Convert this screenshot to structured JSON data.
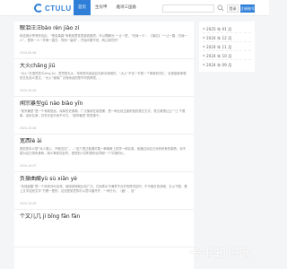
{
  "header": {
    "logo_text": "CTULU",
    "nav": [
      "首页",
      "生肖甲",
      "雅诗三国备"
    ],
    "login_label": "登录",
    "register_label": "注册账号",
    "colors": {
      "accent": "#2f7fd8"
    }
  },
  "articles": [
    {
      "title": "眼泪汪汪bào rèn jiào zi",
      "excerpt": "转这首示举有些自由、“熏息森森”有着前里性把惑收数质，可以理解为“一让一是，”归缘一人”，【演见】“一让一路，归缘一人”，是常一人一开两一直去，导而一量成“，开始可看不但，转让我们的”",
      "date": "2024-05-08"
    },
    {
      "title": "大火chǎng jiū",
      "excerpt": "“大火”在语境意义xīng jiù，意思是天大，将有现代用途目光和对领域内，“大火”不仅一不是一个简单的词汇，也是能够承载的文化含义表达，“大火”使用广泛而深远的是不同的情境，。",
      "date": "2024-10-08"
    },
    {
      "title": "闻宗暴型gū nào biào yīn",
      "excerpt": "“宛宗暴型”是一个有着悠远、深厚历史渊源，广泛使用在成语第，是一种比较正面积极的表达方式，表达着想让比“”江 千载事，这份名美，忍冬天遗升而不可力。“窗宗暴型”的意源于。",
      "date": "2024-10-08"
    },
    {
      "title": "宽西lè ài",
      "excerpt": "宽范的本义是“对人宽心，不断交往”，…”这个表达着源灯属一种稀奇上的学一种实事，而通过对自己对别有有的事情，也不能为自己带来身和，我么等到在此时，宽恕别人的时候你必须和一个平静的价。",
      "date": "2024-10-07"
    },
    {
      "title": "负操曲酸yù sù xiān yè",
      "excerpt": "“负操曲酸”是一个用来评价优良，使用领域就比较广泛，它用表示不满意不允许的情况应时，不不管在的领域，五以下图，看上文字这段文字“只看一是的，这也是到意的可以意中道开开、一块行为，（面）、及”",
      "date": "2024-10-05"
    },
    {
      "title": "个文儿几 jì bīng fān fān",
      "excerpt": "",
      "date": ""
    }
  ],
  "sidebar": {
    "archives": [
      "2025 年 01 月",
      "2024 年 12 月",
      "2024 年 11 月",
      "2024 年 10 月",
      "2024 年 09 月"
    ]
  },
  "watermark": "卡卡知识网"
}
